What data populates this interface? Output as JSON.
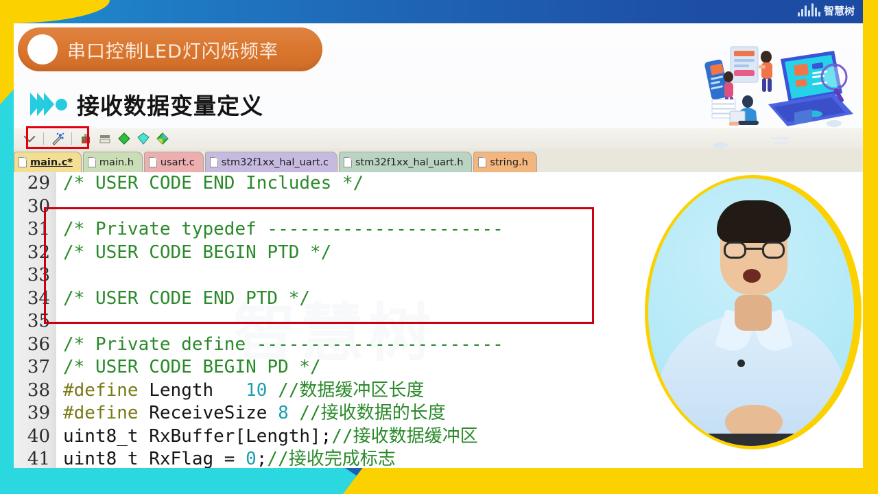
{
  "brand": {
    "name": "智慧树",
    "bars": [
      6,
      11,
      16,
      9,
      19,
      13,
      7
    ]
  },
  "slide": {
    "title_pill": "串口控制LED灯闪烁频率",
    "section_title": "接收数据变量定义",
    "watermark": "智慧树"
  },
  "colors": {
    "accent_orange": "#d9752d",
    "accent_cyan": "#25cbe0",
    "accent_yellow": "#fbd200",
    "header_blue": "#1f63b4",
    "highlight_red": "#c90011",
    "comment_green": "#2a8a2a",
    "keyword_olive": "#7a7a16",
    "number_teal": "#1d9fb0"
  },
  "ide": {
    "toolbar": [
      {
        "name": "chevron-down-icon",
        "glyph": ""
      },
      {
        "name": "separator",
        "glyph": ""
      },
      {
        "name": "magic-wand-icon",
        "glyph": "✨"
      },
      {
        "name": "separator",
        "glyph": ""
      },
      {
        "name": "color-palette-icon",
        "glyph": "🎨"
      },
      {
        "name": "align-icon",
        "glyph": "▤"
      },
      {
        "name": "green-diamond-icon",
        "glyph": "◆"
      },
      {
        "name": "cyan-diamond-icon",
        "glyph": "◆"
      },
      {
        "name": "multicolor-diamond-icon",
        "glyph": "◈"
      }
    ],
    "tabs": [
      {
        "label": "main.c*",
        "color": "#f3df93",
        "active": true
      },
      {
        "label": "main.h",
        "color": "#c9ddb6",
        "active": false
      },
      {
        "label": "usart.c",
        "color": "#edaeb0",
        "active": false
      },
      {
        "label": "stm32f1xx_hal_uart.c",
        "color": "#c7bae0",
        "active": false
      },
      {
        "label": "stm32f1xx_hal_uart.h",
        "color": "#b9d4c2",
        "active": false
      },
      {
        "label": "string.h",
        "color": "#f2b67e",
        "active": false
      }
    ],
    "code": [
      {
        "num": "29",
        "parts": [
          {
            "t": "/* USER CODE END Includes */",
            "c": "cmt"
          }
        ]
      },
      {
        "num": "30",
        "parts": [
          {
            "t": "",
            "c": "txt"
          }
        ]
      },
      {
        "num": "31",
        "parts": [
          {
            "t": "/* Private typedef ----------------------",
            "c": "cmt"
          }
        ]
      },
      {
        "num": "32",
        "parts": [
          {
            "t": "/* USER CODE BEGIN PTD */",
            "c": "cmt"
          }
        ]
      },
      {
        "num": "33",
        "parts": [
          {
            "t": "",
            "c": "txt"
          }
        ]
      },
      {
        "num": "34",
        "parts": [
          {
            "t": "/* USER CODE END PTD */",
            "c": "cmt"
          }
        ]
      },
      {
        "num": "35",
        "parts": [
          {
            "t": "",
            "c": "txt"
          }
        ]
      },
      {
        "num": "36",
        "parts": [
          {
            "t": "/* Private define -----------------------",
            "c": "cmt"
          }
        ]
      },
      {
        "num": "37",
        "parts": [
          {
            "t": "/* USER CODE BEGIN PD */",
            "c": "cmt"
          }
        ]
      },
      {
        "num": "38",
        "parts": [
          {
            "t": "#define",
            "c": "kw"
          },
          {
            "t": " Length   ",
            "c": "txt"
          },
          {
            "t": "10",
            "c": "num"
          },
          {
            "t": " ",
            "c": "txt"
          },
          {
            "t": "//数据缓冲区长度",
            "c": "cmt"
          }
        ]
      },
      {
        "num": "39",
        "parts": [
          {
            "t": "#define",
            "c": "kw"
          },
          {
            "t": " ReceiveSize ",
            "c": "txt"
          },
          {
            "t": "8",
            "c": "num"
          },
          {
            "t": " ",
            "c": "txt"
          },
          {
            "t": "//接收数据的长度",
            "c": "cmt"
          }
        ]
      },
      {
        "num": "40",
        "parts": [
          {
            "t": "uint8_t RxBuffer[Length];",
            "c": "txt"
          },
          {
            "t": "//接收数据缓冲区",
            "c": "cmt"
          }
        ]
      },
      {
        "num": "41",
        "parts": [
          {
            "t": "uint8_t RxFlag = ",
            "c": "txt"
          },
          {
            "t": "0",
            "c": "num"
          },
          {
            "t": ";",
            "c": "txt"
          },
          {
            "t": "//接收完成标志",
            "c": "cmt"
          }
        ]
      }
    ],
    "highlighted_lines": [
      "37",
      "38",
      "39",
      "40",
      "41"
    ]
  }
}
